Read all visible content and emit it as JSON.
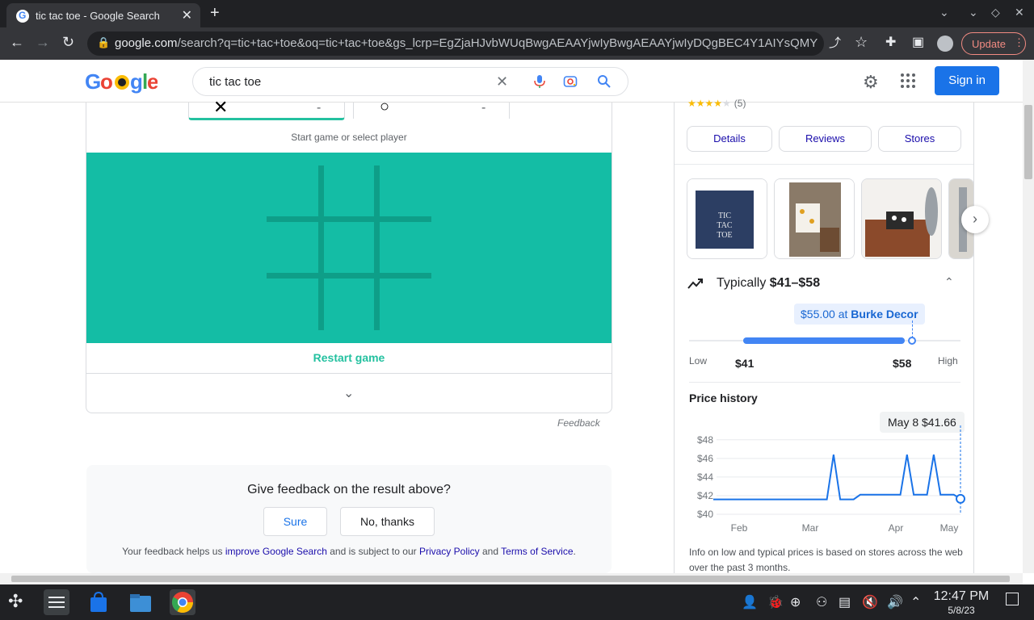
{
  "browser": {
    "tab_title": "tic tac toe - Google Search",
    "url_host": "google.com",
    "url_path": "/search?q=tic+tac+toe&oq=tic+tac+toe&gs_lcrp=EgZjaHJvbWUqBwgAEAAYjwIyBwgAEAAYjwIyDQgBEC4Y1AIYsQMYgAQ...",
    "update_label": "Update"
  },
  "header": {
    "logo": "Google",
    "query": "tic tac toe",
    "signin_label": "Sign in"
  },
  "game": {
    "player_x_symbol": "✕",
    "player_x_score": "-",
    "player_o_symbol": "○",
    "player_o_score": "-",
    "hint": "Start game or select player",
    "restart_label": "Restart game",
    "board_color": "#14bda5",
    "accent_color": "#24c1a0"
  },
  "feedback_link": "Feedback",
  "feedback_panel": {
    "question": "Give feedback on the result above?",
    "sure_label": "Sure",
    "no_label": "No, thanks",
    "note_prefix": "Your feedback helps us ",
    "note_link1": "improve Google Search",
    "note_mid": " and is subject to our ",
    "note_link2": "Privacy Policy",
    "note_and": " and ",
    "note_link3": "Terms of Service",
    "note_end": "."
  },
  "product": {
    "rating_count": "(5)",
    "tabs": [
      "Details",
      "Reviews",
      "Stores"
    ],
    "thumb1_text": "TIC TAC TOE",
    "typical_label": "Typically ",
    "typical_range": "$41–$58",
    "price_tag_price": "$55.00",
    "price_tag_at": " at ",
    "price_tag_store": "Burke Decor",
    "range_low_label": "Low",
    "range_low_value": "$41",
    "range_high_value": "$58",
    "range_high_label": "High",
    "range_marker_fraction": 0.82,
    "history_title": "Price history",
    "history_badge": "May 8 $41.66",
    "history_note": "Info on low and typical prices is based on stores across the web over the past 3 months."
  },
  "chart_data": {
    "type": "line",
    "title": "Price history",
    "x_ticks": [
      "Feb",
      "Mar",
      "Apr",
      "May"
    ],
    "y_ticks": [
      "$48",
      "$46",
      "$44",
      "$42",
      "$40"
    ],
    "ylim": [
      40,
      48.5
    ],
    "series": [
      {
        "values": [
          41.6,
          41.6,
          41.6,
          41.6,
          41.6,
          41.6,
          41.6,
          41.6,
          41.6,
          41.6,
          41.6,
          41.6,
          41.6,
          41.6,
          41.6,
          41.6,
          41.6,
          41.6,
          46.4,
          41.6,
          41.6,
          41.6,
          42.1,
          42.1,
          42.1,
          42.1,
          42.1,
          42.1,
          42.1,
          46.4,
          42.1,
          42.1,
          42.1,
          46.4,
          42.1,
          42.1,
          42.1,
          41.66
        ]
      }
    ],
    "line_color": "#1a73e8"
  },
  "taskbar": {
    "time": "12:47 PM",
    "date": "5/8/23"
  }
}
